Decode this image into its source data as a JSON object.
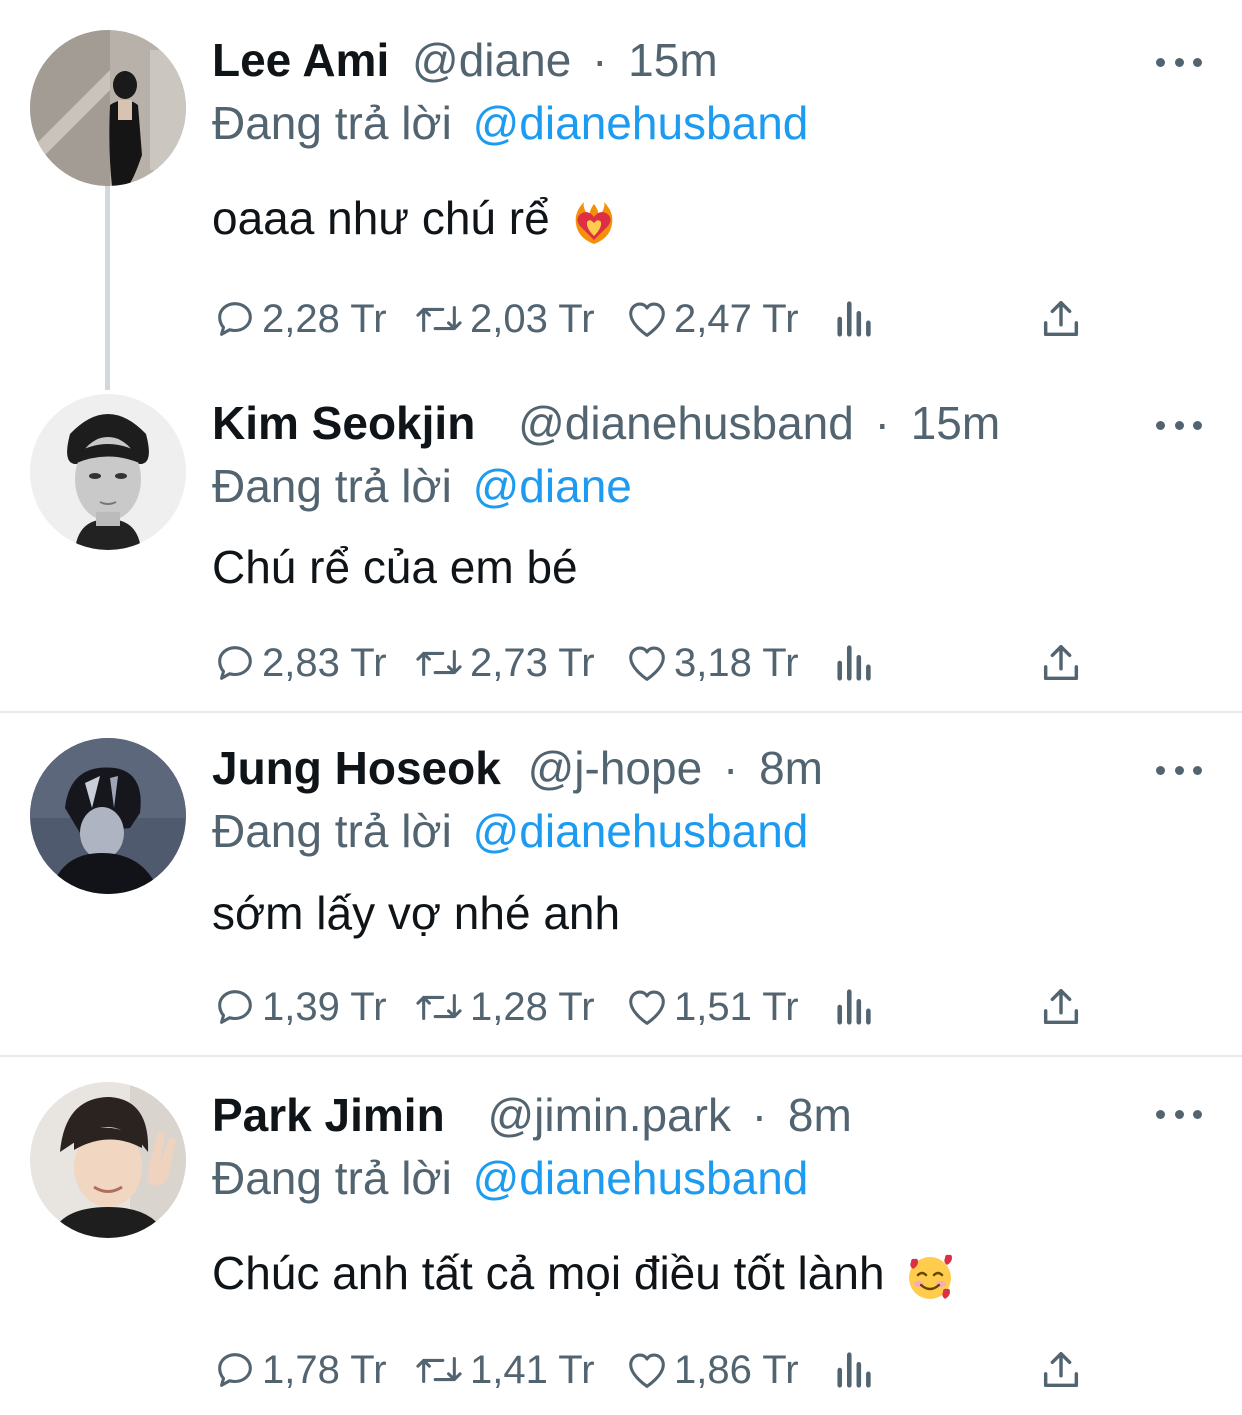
{
  "reply_prefix": "Đang trả lời",
  "colors": {
    "accent": "#1d9bf0",
    "secondary_text": "#536471",
    "primary_text": "#0f1419",
    "divider": "#e7e9ea"
  },
  "tweets": [
    {
      "name": "Lee Ami",
      "handle": "@diane",
      "sep": "·",
      "time": "15m",
      "reply_to": "@dianehusband",
      "text": "oaaa như chú rể",
      "emoji": "heart-on-fire-emoji",
      "replies": "2,28 Tr",
      "retweets": "2,03 Tr",
      "likes": "2,47 Tr"
    },
    {
      "name": "Kim Seokjin",
      "handle": "@dianehusband",
      "sep": "·",
      "time": "15m",
      "reply_to": "@diane",
      "text": "Chú rể của em bé",
      "replies": "2,83 Tr",
      "retweets": "2,73 Tr",
      "likes": "3,18 Tr"
    },
    {
      "name": "Jung Hoseok",
      "handle": "@j-hope",
      "sep": "·",
      "time": "8m",
      "reply_to": "@dianehusband",
      "text": "sớm lấy vợ nhé anh",
      "replies": "1,39 Tr",
      "retweets": "1,28 Tr",
      "likes": "1,51 Tr"
    },
    {
      "name": "Park Jimin",
      "handle": "@jimin.park",
      "sep": "·",
      "time": "8m",
      "reply_to": "@dianehusband",
      "text": "Chúc anh tất cả mọi điều tốt lành",
      "emoji": "smiling-face-with-hearts-emoji",
      "replies": "1,78 Tr",
      "retweets": "1,41 Tr",
      "likes": "1,86 Tr"
    }
  ]
}
